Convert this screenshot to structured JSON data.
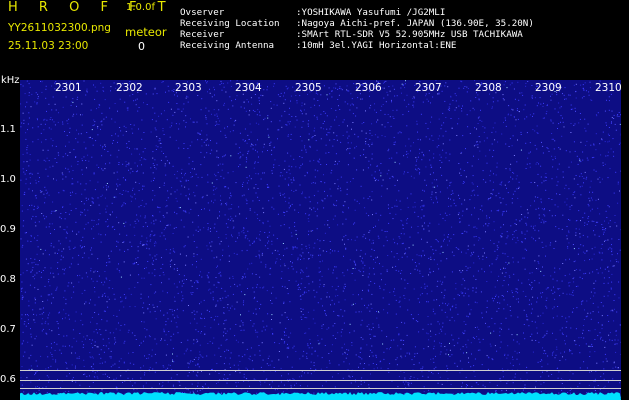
{
  "header": {
    "brand": "H R O F F T",
    "version": "1.0.0f",
    "filename": "YY2611032300.png",
    "meteor_label": "meteor",
    "datetime": "25.11.03 23:00",
    "meteor_count": "0",
    "info": [
      {
        "key": "Ovserver",
        "value": ":YOSHIKAWA Yasufumi /JG2MLI"
      },
      {
        "key": "Receiving Location",
        "value": ":Nagoya Aichi-pref. JAPAN (136.90E, 35.20N)"
      },
      {
        "key": "Receiver",
        "value": ":SMArt RTL-SDR V5 52.905MHz USB TACHIKAWA"
      },
      {
        "key": "Receiving Antenna",
        "value": ":10mH 3el.YAGI Horizontal:ENE"
      }
    ]
  },
  "axes": {
    "unit": "kHz",
    "time_ticks": [
      "2301",
      "2302",
      "2303",
      "2304",
      "2305",
      "2306",
      "2307",
      "2308",
      "2309",
      "2310"
    ],
    "freq_ticks": [
      "1.1",
      "1.0",
      "0.9",
      "0.8",
      "0.7",
      "0.6"
    ]
  },
  "colors": {
    "background": "#000000",
    "plot": "#0d0d84",
    "noise": "#3c3cff",
    "baseline": "#00e0ff",
    "yellow": "#e8e800"
  }
}
